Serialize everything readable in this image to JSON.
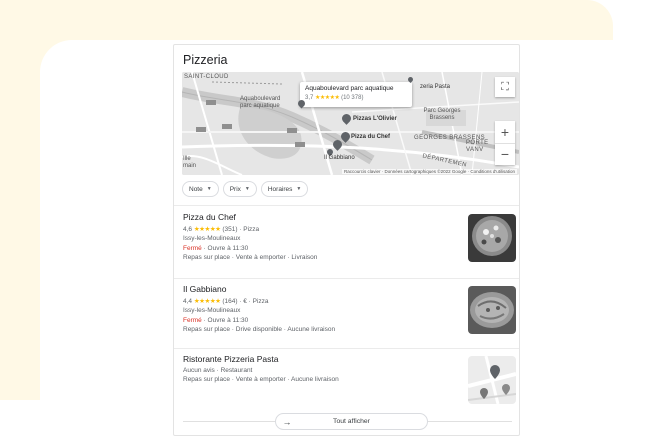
{
  "title": "Pizzeria",
  "map": {
    "labels": {
      "saint_cloud": "SAINT-CLOUD",
      "aquaboulevard": "Aquaboulevard parc aquatique",
      "zeria_pasta": "zeria Pasta",
      "parc_georges": "Parc Georges Brassens",
      "georges_brassens": "GEORGES BRASSENS",
      "porte": "PORTE VANV",
      "departement": "DÉPARTEMEN",
      "ille": "Ille main",
      "pizzas_lolivier": "Pizzas L'Olivier",
      "pizza_du_chef": "Pizza du Chef",
      "il_gabbiano": "Il Gabbiano"
    },
    "tooltip": {
      "name": "Aquaboulevard parc aquatique",
      "rating": "3,7",
      "stars": "★★★★★",
      "count": "(10 378)"
    },
    "attribution": "Raccourcis clavier · Données cartographiques ©2022 Google · Conditions d'utilisation",
    "controls": {
      "expand_icon": "expand-icon",
      "zoom_in": "+",
      "zoom_out": "−"
    }
  },
  "filters": [
    {
      "label": "Note"
    },
    {
      "label": "Prix"
    },
    {
      "label": "Horaires"
    }
  ],
  "results": [
    {
      "name": "Pizza du Chef",
      "rating": "4,6",
      "stars": "★★★★★",
      "meta": "(351) · Pizza",
      "city": "Issy-les-Moulineaux",
      "status": "Fermé",
      "opens": " · Ouvre à 11:30",
      "services": "Repas sur place · Vente à emporter · Livraison"
    },
    {
      "name": "Il Gabbiano",
      "rating": "4,4",
      "stars": "★★★★★",
      "meta": "(164) · € · Pizza",
      "city": "Issy-les-Moulineaux",
      "status": "Fermé",
      "opens": " · Ouvre à 11:30",
      "services": "Repas sur place · Drive disponible · Aucune livraison"
    },
    {
      "name": "Ristorante Pizzeria Pasta",
      "line1": "Aucun avis · Restaurant",
      "services": "Repas sur place · Vente à emporter · Aucune livraison"
    }
  ],
  "more_button": {
    "label": "Tout afficher",
    "arrow": "→"
  }
}
